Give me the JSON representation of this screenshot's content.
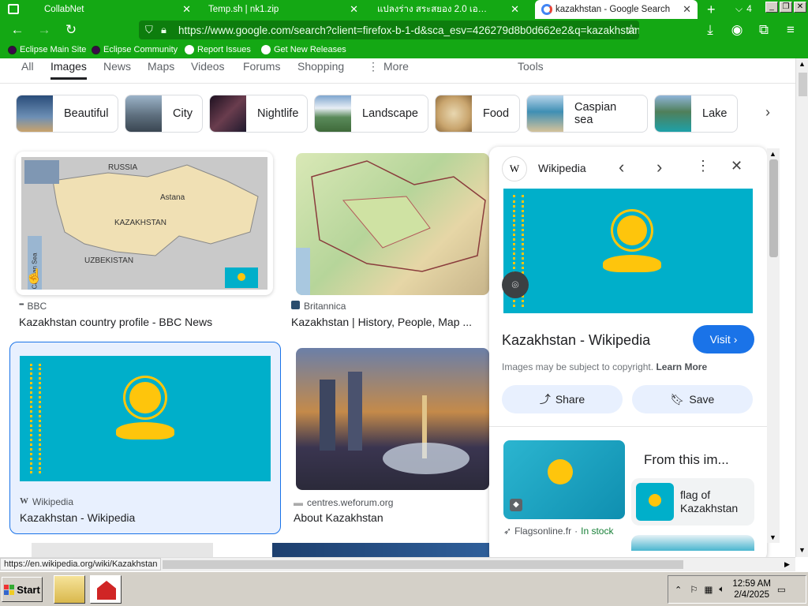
{
  "browser": {
    "tabs": [
      {
        "label": "CollabNet",
        "active": false
      },
      {
        "label": "Temp.sh | nk1.zip",
        "active": false
      },
      {
        "label": "แปลงร่าง สระสยอง 2.0 เอ…",
        "active": false
      },
      {
        "label": "kazakhstan - Google Search",
        "active": true
      }
    ],
    "tab_count": "4",
    "new_tab": "+",
    "url": "https://www.google.com/search?client=firefox-b-1-d&sca_esv=426279d8b0d662e2&q=kazakhstan",
    "bookmarks": [
      "Eclipse Main Site",
      "Eclipse Community",
      "Report Issues",
      "Get New Releases"
    ]
  },
  "google": {
    "nav_tabs": [
      "All",
      "Images",
      "News",
      "Maps",
      "Videos",
      "Forums",
      "Shopping",
      "More",
      "Tools"
    ],
    "chips": [
      "Beautiful",
      "City",
      "Nightlife",
      "Landscape",
      "Food",
      "Caspian sea",
      "Lake"
    ],
    "results": [
      {
        "source": "BBC",
        "title": "Kazakhstan country profile - BBC News"
      },
      {
        "source": "Britannica",
        "title": "Kazakhstan | History, People, Map ..."
      },
      {
        "source": "Wikipedia",
        "title": "Kazakhstan - Wikipedia"
      },
      {
        "source": "centres.weforum.org",
        "title": "About Kazakhstan"
      }
    ],
    "map_labels": {
      "russia": "RUSSIA",
      "astana": "Astana",
      "kazakhstan": "KAZAKHSTAN",
      "uzbekistan": "UZBEKISTAN",
      "caspian": "Caspian Sea"
    }
  },
  "panel": {
    "site": "Wikipedia",
    "site_letter": "W",
    "title": "Kazakhstan - Wikipedia",
    "visit": "Visit",
    "copyright": "Images may be subject to copyright.",
    "learn_more": "Learn More",
    "share": "Share",
    "save": "Save",
    "related_source": "Flagsonline.fr",
    "in_stock": "In stock",
    "from_this": "From this im...",
    "related_label": "flag of Kazakhstan"
  },
  "status_url": "https://en.wikipedia.org/wiki/Kazakhstan",
  "taskbar": {
    "start": "Start",
    "time": "12:59 AM",
    "date": "2/4/2025"
  },
  "colors": {
    "browser_green": "#14a814",
    "flag_blue": "#00afca",
    "flag_gold": "#fec50c",
    "visit_blue": "#1a73e8"
  }
}
